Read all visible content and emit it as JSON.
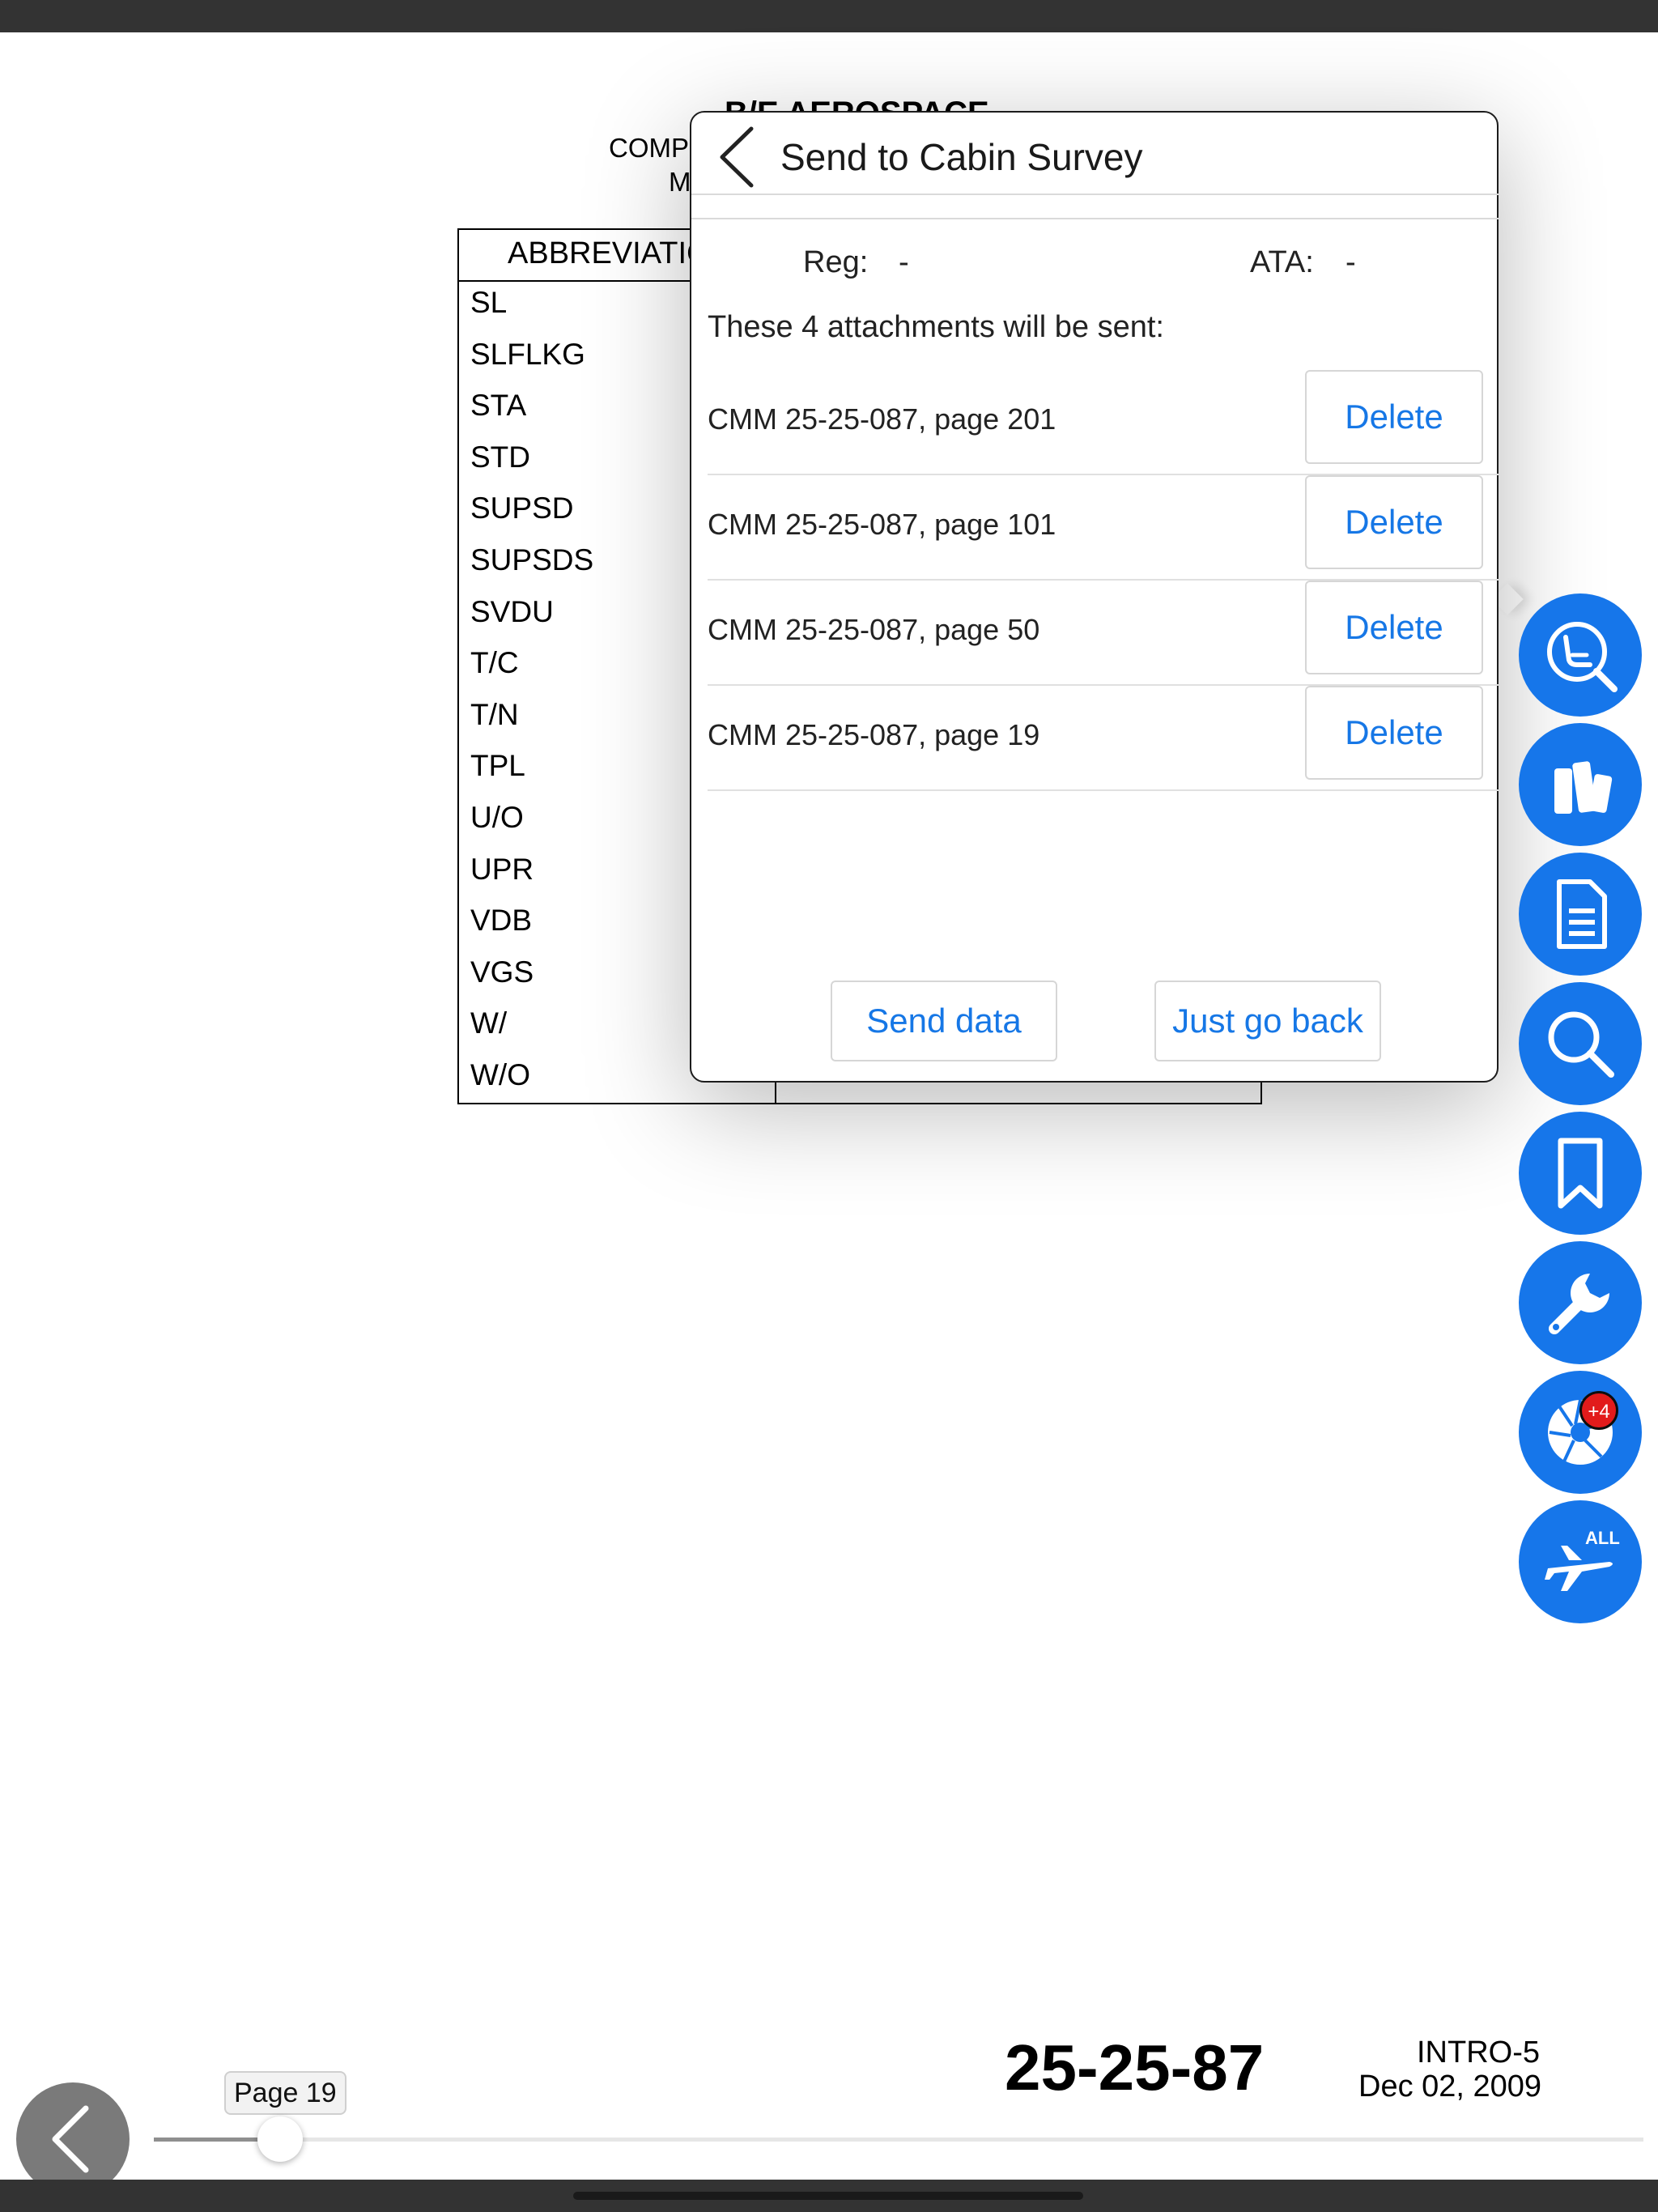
{
  "document": {
    "header_line1": "B/E AEROSPACE",
    "header_line2": "COMP",
    "header_line3": "M",
    "table_header": "ABBREVIATIC",
    "abbreviations": [
      "SL",
      "SLFLKG",
      "STA",
      "STD",
      "SUPSD",
      "SUPSDS",
      "SVDU",
      "T/C",
      "T/N",
      "TPL",
      "U/O",
      "UPR",
      "VDB",
      "VGS",
      "W/",
      "W/O"
    ],
    "footer_code": "25-25-87",
    "footer_section": "INTRO-5",
    "footer_date": "Dec 02, 2009"
  },
  "popover": {
    "title": "Send to Cabin Survey",
    "reg_label": "Reg:",
    "reg_value": "-",
    "ata_label": "ATA:",
    "ata_value": "-",
    "attachments_message": "These 4 attachments will be sent:",
    "attachments": [
      {
        "name": "CMM 25-25-087, page 201",
        "action": "Delete"
      },
      {
        "name": "CMM 25-25-087, page 101",
        "action": "Delete"
      },
      {
        "name": "CMM 25-25-087, page 50",
        "action": "Delete"
      },
      {
        "name": "CMM 25-25-087, page 19",
        "action": "Delete"
      }
    ],
    "send_button": "Send data",
    "back_button": "Just go back"
  },
  "sidebar_buttons": [
    {
      "icon": "seat-search-icon"
    },
    {
      "icon": "manuals-icon"
    },
    {
      "icon": "document-icon"
    },
    {
      "icon": "search-icon"
    },
    {
      "icon": "bookmark-icon"
    },
    {
      "icon": "wrench-icon"
    },
    {
      "icon": "camera-aperture-icon",
      "badge": "+4"
    },
    {
      "icon": "airplane-all-icon",
      "label": "ALL"
    }
  ],
  "navigation": {
    "page_label": "Page 19",
    "page_progress": 0.05
  },
  "colors": {
    "accent": "#1676ea",
    "link": "#1677e6",
    "badge": "#e21b1b",
    "bars": "#333333"
  }
}
